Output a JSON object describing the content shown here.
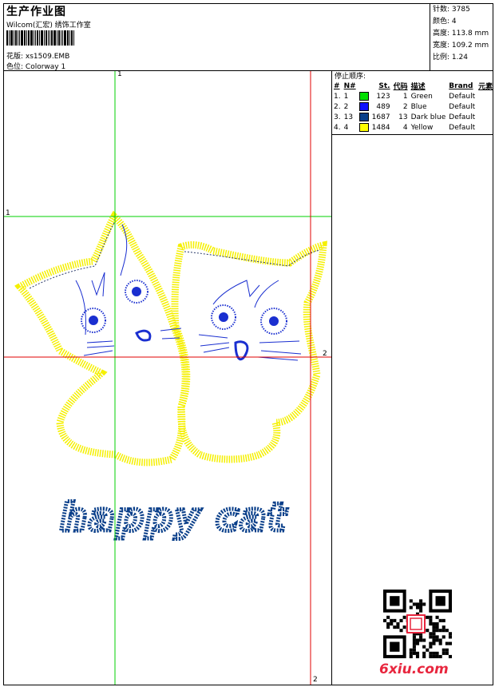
{
  "header": {
    "title": "生产作业图",
    "company": "Wilcom(汇宏) 绣饰工作室",
    "design_label": "花版:",
    "design_value": "xs1509.EMB",
    "colorway_label": "色位:",
    "colorway_value": "Colorway 1"
  },
  "stats": [
    {
      "label": "针数:",
      "value": "3785"
    },
    {
      "label": "颜色:",
      "value": "4"
    },
    {
      "label": "高度:",
      "value": "113.8 mm"
    },
    {
      "label": "宽度:",
      "value": "109.2 mm"
    },
    {
      "label": "比例:",
      "value": "1.24"
    }
  ],
  "stop_sequence": {
    "title": "停止顺序:",
    "columns": [
      "#",
      "N#",
      "St.",
      "代码",
      "描述",
      "Brand",
      "元素"
    ],
    "rows": [
      {
        "idx": "1.",
        "n": "1",
        "color": "#00e000",
        "st": "123",
        "code": "1",
        "desc": "Green",
        "brand": "Default"
      },
      {
        "idx": "2.",
        "n": "2",
        "color": "#1010ff",
        "st": "489",
        "code": "2",
        "desc": "Blue",
        "brand": "Default"
      },
      {
        "idx": "3.",
        "n": "13",
        "color": "#0a3f8a",
        "st": "1687",
        "code": "13",
        "desc": "Dark blue",
        "brand": "Default"
      },
      {
        "idx": "4.",
        "n": "4",
        "color": "#ffff00",
        "st": "1484",
        "code": "4",
        "desc": "Yellow",
        "brand": "Default"
      }
    ]
  },
  "guides": {
    "green_v": "1",
    "green_h": "1",
    "red_h": "2",
    "red_v": "2"
  },
  "artwork": {
    "text": "happy cat",
    "text_color": "#0a3f8a",
    "outline_color": "#f5f000",
    "eye_color": "#1a2fd0"
  },
  "watermark": "6xiu.com"
}
